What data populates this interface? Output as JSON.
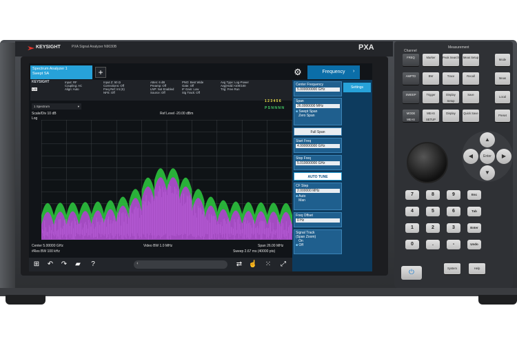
{
  "device": {
    "brand": "KEYSIGHT",
    "model_line": "PXA Signal Analyzer   N9030B   ",
    "badge": "PXA"
  },
  "tabs": {
    "active_line1": "Spectrum Analyzer 1",
    "active_line2": "Swept SA",
    "add_symbol": "+"
  },
  "menu": {
    "current": "Frequency",
    "settings_tab": "Settings"
  },
  "status": {
    "logo": "KEYSIGHT",
    "col1": "Input: RF\nCoupling: AC\nAlign: Auto",
    "col2": "Input Z: 50 Ω\nCorrections: Off\nFreq Ref: Int (S)\nNFE: Off",
    "col3": "Atten: 6 dB\nPreamp: Off\nLNP: Not Enabled\nSource: Off",
    "col4": "PNO: Best Wide\nGate: Off\nIF Gain: Low\nSig Track: Off",
    "col5": "Avg Type: Log-Power\nAvg|Hold:>100/100\nTrig: Free Run",
    "trace_row1": "1 2 3 4 5 6",
    "trace_row2": "P S N N N N"
  },
  "window": {
    "dropdown": "1 Spectrum",
    "scale": "Scale/Div 10 dB",
    "log": "Log",
    "ref_level": "Ref Level -20.00 dBm"
  },
  "bottom": {
    "center": "Center 5.00000 GHz",
    "res_bw": "#Res BW 100 kHz",
    "video_bw": "Video BW 1.0 MHz",
    "span": "Span 26.00 MHz",
    "sweep": "Sweep 2.67 ms (40000 pts)"
  },
  "panel": {
    "center_freq_label": "Center Frequency",
    "center_freq_value": "5.000000000 GHz",
    "span_label": "Span",
    "span_value": "26.0000000 MHz",
    "swept_span": "Swept Span",
    "zero_span": "Zero Span",
    "full_span": "Full Span",
    "start_freq_label": "Start Freq",
    "start_freq_value": "4.990000000 GHz",
    "stop_freq_label": "Stop Freq",
    "stop_freq_value": "5.010000000 GHz",
    "auto_tune": "AUTO TUNE",
    "cf_step_label": "CF Step",
    "cf_step_value": "2.000000 MHz",
    "auto": "Auto",
    "man": "Man",
    "freq_offset_label": "Freq Offset",
    "freq_offset_value": "0 Hz",
    "signal_track_label": "Signal Track",
    "signal_track_sub": "(Span Zoom)",
    "on": "On",
    "off": "Off"
  },
  "keys": {
    "channel_header": "Channel",
    "measurement_header": "Measurement",
    "rows": [
      [
        "FREQ",
        "Marker",
        "Peak Search",
        "Meas Setup"
      ],
      [
        "AMPTD",
        "BW",
        "Trace",
        "Recall"
      ],
      [
        "SWEEP",
        "Trigger",
        "Display Setup",
        "Save"
      ],
      [
        "MODE MEAS",
        "MEAS SETUP",
        "Display",
        "Quick Save"
      ]
    ],
    "side_col": [
      "Mode",
      "Meas",
      "Local",
      "Preset"
    ],
    "numbers": [
      [
        "7",
        "8",
        "9",
        "Esc"
      ],
      [
        "4",
        "5",
        "6",
        "Tab"
      ],
      [
        "1",
        "2",
        "3",
        "Enter"
      ],
      [
        "0",
        ".",
        "-",
        "Undo"
      ]
    ],
    "enter": "Enter",
    "system": "System",
    "help": "Help"
  },
  "colors": {
    "accent_blue": "#27a2d9",
    "trace_green": "#2ecc40",
    "trace_purple": "#b040d0"
  }
}
